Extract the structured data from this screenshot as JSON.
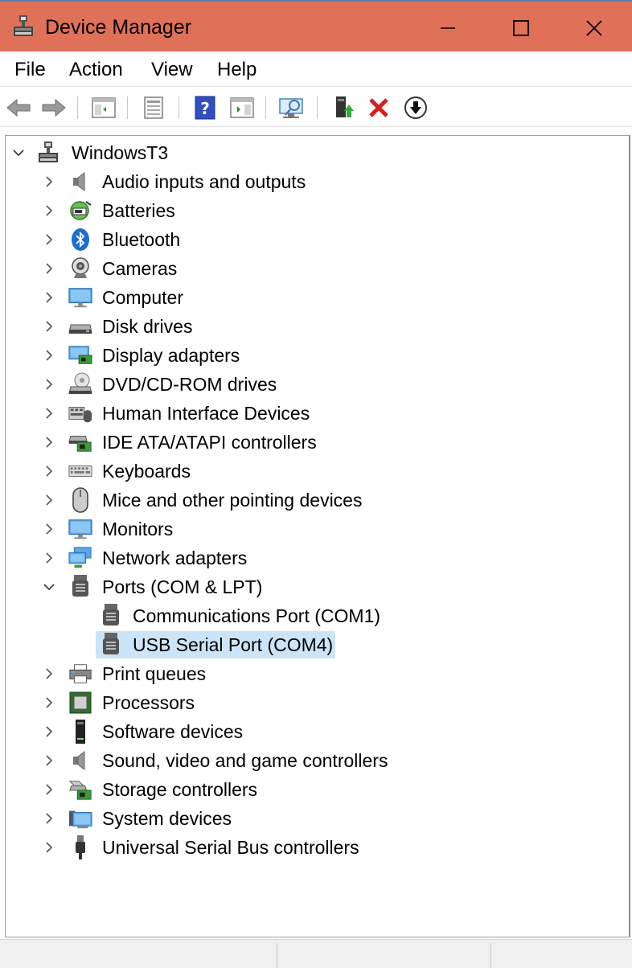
{
  "window": {
    "title": "Device Manager",
    "title_bar_color": "#e07159"
  },
  "menu": [
    "File",
    "Action",
    "View",
    "Help"
  ],
  "toolbar": {
    "buttons": [
      "back-icon",
      "forward-icon",
      "show-hide-console-tree-icon",
      "properties-icon",
      "help-icon",
      "action-pane-icon",
      "scan-hardware-icon",
      "update-driver-icon",
      "uninstall-icon",
      "disable-device-icon"
    ]
  },
  "tree": {
    "root": "WindowsT3",
    "categories": [
      "Audio inputs and outputs",
      "Batteries",
      "Bluetooth",
      "Cameras",
      "Computer",
      "Disk drives",
      "Display adapters",
      "DVD/CD-ROM drives",
      "Human Interface Devices",
      "IDE ATA/ATAPI controllers",
      "Keyboards",
      "Mice and other pointing devices",
      "Monitors",
      "Network adapters",
      "Ports (COM & LPT)",
      "Print queues",
      "Processors",
      "Software devices",
      "Sound, video and game controllers",
      "Storage controllers",
      "System devices",
      "Universal Serial Bus controllers"
    ],
    "ports_children": [
      "Communications Port (COM1)",
      "USB Serial Port (COM4)"
    ],
    "selected": "USB Serial Port (COM4)",
    "selection_color": "#cce4f7"
  }
}
